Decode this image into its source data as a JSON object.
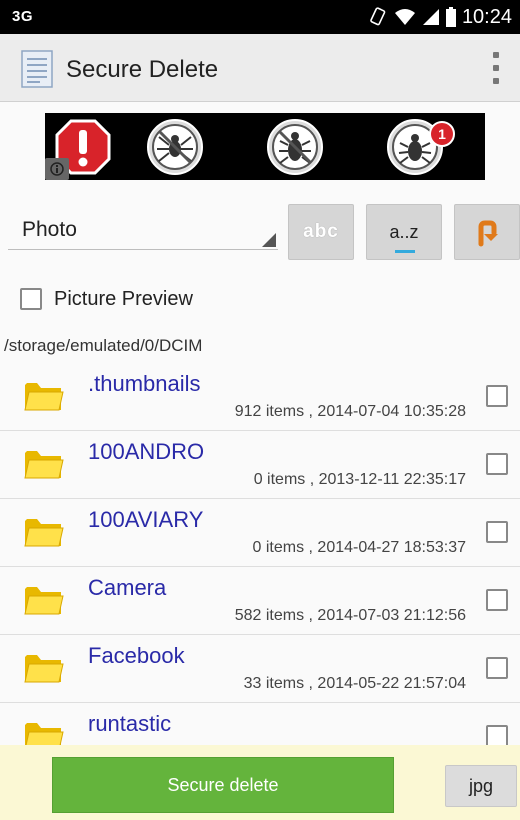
{
  "status_bar": {
    "network": "3G",
    "time": "10:24"
  },
  "app": {
    "title": "Secure Delete"
  },
  "ad": {
    "icons": [
      "stop-alert-icon",
      "no-spider-icon",
      "no-bug-icon",
      "bug-notification-icon"
    ],
    "badge": "1"
  },
  "filter": {
    "selected": "Photo",
    "abc_label": "abc",
    "az_label": "a..z"
  },
  "preview": {
    "label": "Picture Preview",
    "checked": false
  },
  "path": "/storage/emulated/0/DCIM",
  "files": [
    {
      "name": ".thumbnails",
      "meta": "912 items , 2014-07-04 10:35:28"
    },
    {
      "name": "100ANDRO",
      "meta": "0 items , 2013-12-11 22:35:17"
    },
    {
      "name": "100AVIARY",
      "meta": "0 items , 2014-04-27 18:53:37"
    },
    {
      "name": "Camera",
      "meta": "582 items , 2014-07-03 21:12:56"
    },
    {
      "name": "Facebook",
      "meta": "33 items , 2014-05-22 21:57:04"
    },
    {
      "name": "runtastic",
      "meta": ""
    }
  ],
  "bottom": {
    "delete_label": "Secure delete",
    "ext_label": "jpg"
  },
  "colors": {
    "accent_green": "#64b43c",
    "link_blue": "#2a2aa8",
    "bottom_bg": "#fbf8d4"
  }
}
